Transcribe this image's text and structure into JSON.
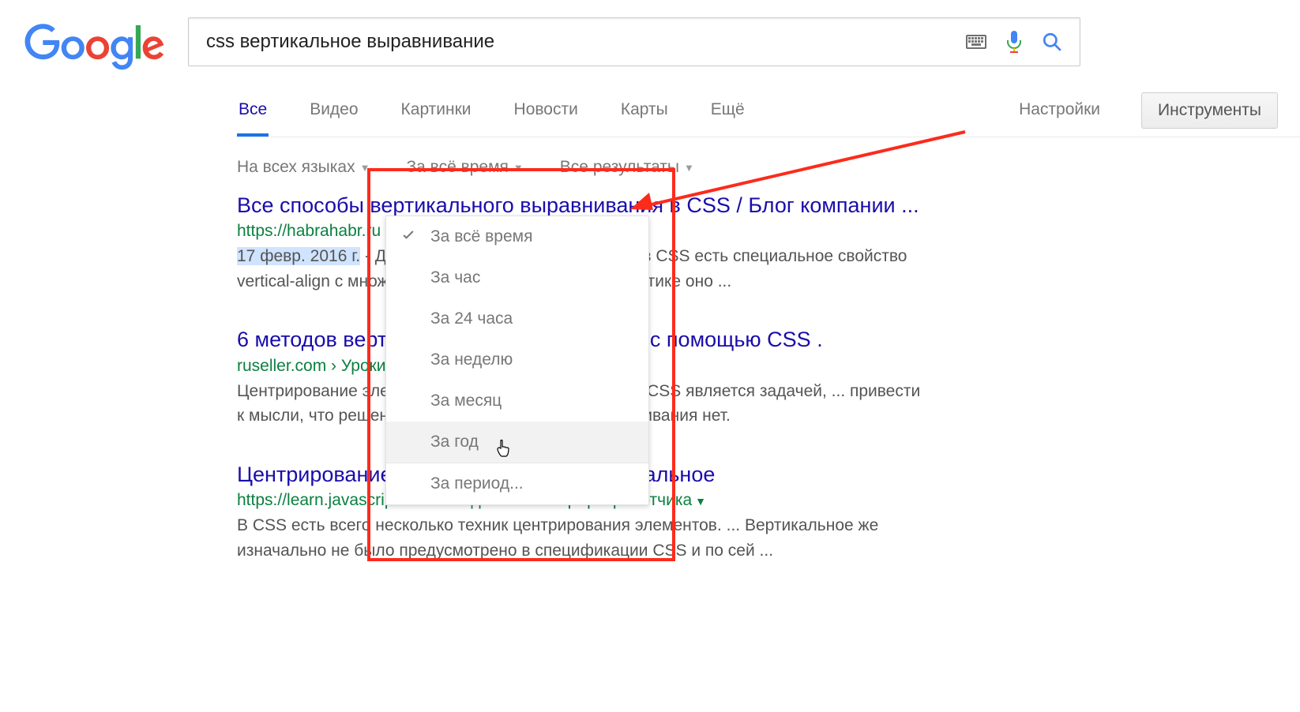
{
  "search": {
    "query": "css вертикальное выравнивание"
  },
  "tabs": {
    "all": "Все",
    "video": "Видео",
    "images": "Картинки",
    "news": "Новости",
    "maps": "Карты",
    "more": "Ещё",
    "settings": "Настройки",
    "tools": "Инструменты"
  },
  "filters": {
    "lang": "На всех языках",
    "time": "За всё время",
    "results": "Все результаты"
  },
  "dropdown": {
    "items": [
      "За всё время",
      "За час",
      "За 24 часа",
      "За неделю",
      "За месяц",
      "За год",
      "За период..."
    ],
    "selected_index": 0,
    "hover_index": 5
  },
  "results": [
    {
      "title": "Все способы вертикального выравнивания в CSS / Блог компании ...",
      "url": "https://habrahabr.ru › Блог компании ... › 277433/",
      "date_prefix": "17 февр. 2016 г.",
      "snippet": " - Для вертикального выравнивания в CSS есть специальное свойство vertical-align с множеством значений. Однако на практике оно ..."
    },
    {
      "title": "6 методов вертикального центрирования с помощью CSS .",
      "url": "ruseller.com › Уроки",
      "snippet": "Центрирование элементов по вертикали с помощью CSS является задачей, ... привести к мысли, что решения задачи вертикального выравнивания нет."
    },
    {
      "title": "Центрирование горизонтальное и вертикальное",
      "url": "https://learn.javascript.ru › CSS для JavaScript-разработчика",
      "snippet": "В CSS есть всего несколько техник центрирования элементов. ... Вертикальное же изначально не было предусмотрено в спецификации CSS и по сей ..."
    }
  ]
}
